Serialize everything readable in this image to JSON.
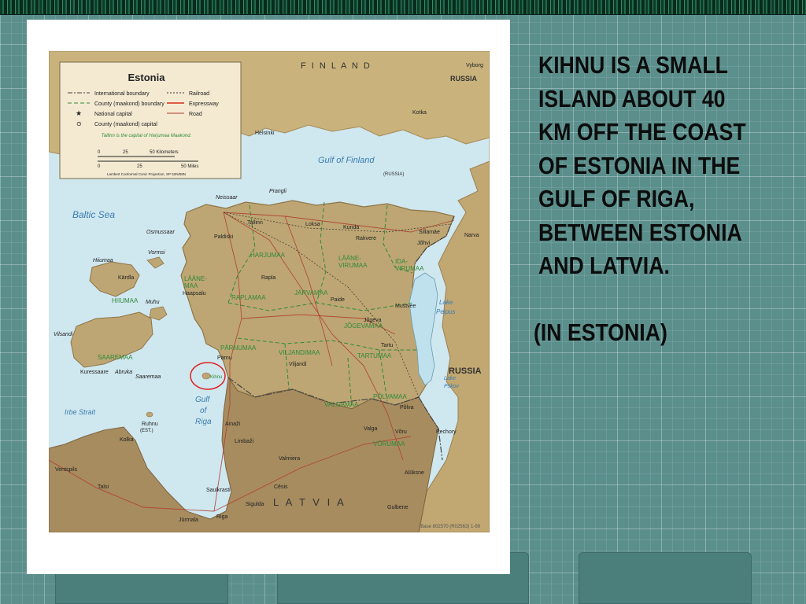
{
  "slide": {
    "text_lines": [
      "KIHNU IS A SMALL",
      "ISLAND ABOUT 40",
      "KM OFF THE COAST",
      "OF ESTONIA IN THE",
      "GULF OF RIGA,",
      "BETWEEN ESTONIA",
      "AND LATVIA."
    ],
    "subtext": "(IN ESTONIA)"
  },
  "map": {
    "legend": {
      "title": "Estonia",
      "international_boundary": "International boundary",
      "county_boundary": "County (maakond) boundary",
      "national_capital": "National capital",
      "county_capital": "County (maakond) capital",
      "railroad": "Railroad",
      "expressway": "Expressway",
      "road": "Road",
      "note": "Tallinn is the capital of Harjumaa Maakond.",
      "scale_km": "50 Kilometers",
      "scale_miles": "50 Miles",
      "scale_zero": "0",
      "scale_25": "25",
      "projection": "Lambert Conformal Conic Projection, SP 52N/58N"
    },
    "seas": {
      "baltic_sea": "Baltic Sea",
      "gulf_of_finland": "Gulf of Finland",
      "gulf_of_riga": [
        "Gulf",
        "of",
        "Riga"
      ],
      "irbe_strait": "Irbe Strait",
      "lake_peipus": [
        "Lake",
        "Peipus"
      ],
      "lake_pskov": [
        "Lake",
        "Pskov"
      ]
    },
    "countries": {
      "finland": "F I N L A N D",
      "russia_top": "RUSSIA",
      "russia_right": "RUSSIA",
      "latvia": "L A T V I A",
      "russia_islands": "(RUSSIA)",
      "kihnu_est": "(EST.)"
    },
    "counties": [
      "HARJUMAA",
      "LÄÄNE-\nVIRUMAA",
      "IDA-\nVIRUMAA",
      "LÄÄNE-\nMAA",
      "RAPLAMAA",
      "JÄRVAMAA",
      "HIIUMAA",
      "SAAREMAA",
      "PÄRNUMAA",
      "VILJANDIMAA",
      "JÕGEVAMAA",
      "TARTUMAA",
      "VALGAMAA",
      "PÕLVAMAA",
      "VÕRUMAA"
    ],
    "cities": {
      "tallinn": "Tallinn",
      "helsinki": "Helsinki",
      "riga": "Riga",
      "narva": "Narva",
      "tartu": "Tartu",
      "parnu": "Pärnu",
      "kihnu": "Kihnu",
      "kardla": "Kärdla",
      "haapsalu": "Haapsalu",
      "kuressaare": "Kuressaare",
      "paide": "Paide",
      "rakvere": "Rakvere",
      "johvi": "Jõhvi",
      "viljandi": "Viljandi",
      "valga": "Valga",
      "voru": "Võru",
      "polva": "Põlva",
      "jogeva": "Jõgeva",
      "rapla": "Rapla",
      "paldiski": "Paldiski",
      "sillamae": "Sillamäe",
      "kotka": "Kotka",
      "vyborg": "Vyborg",
      "ruhnu": "Ruhnu",
      "ainazi": "Ainaži",
      "valmiera": "Valmiera",
      "cesis": "Cēsis",
      "sigulda": "Sigulda",
      "jurmala": "Jūrmala",
      "ventspils": "Ventspils",
      "talsi": "Talsi",
      "kolka": "Kolka",
      "gulbene": "Gulbene",
      "aluksne": "Alūksne",
      "pechory": "Pechory",
      "mustvee": "Mustvee",
      "saulkrasti": "Saulkrasti",
      "limbazi": "Limbaži",
      "kunda": "Kunda",
      "loksa": "Loksa",
      "kardla_fi": "Kotka",
      "hiiumaa_island": "Hiiumaa",
      "saaremaa_island": "Saaremaa",
      "vormsi": "Vormsi",
      "muhu": "Muhu",
      "osmussaar": "Osmussaar",
      "neissaar": "Neissaar",
      "prangli": "Prangli",
      "vilsandi": "Vilsandi",
      "abruka": "Abruka"
    },
    "footer": "Base 802570 (R02563) 1-99",
    "kihnu_highlight_color": "#e02020"
  }
}
